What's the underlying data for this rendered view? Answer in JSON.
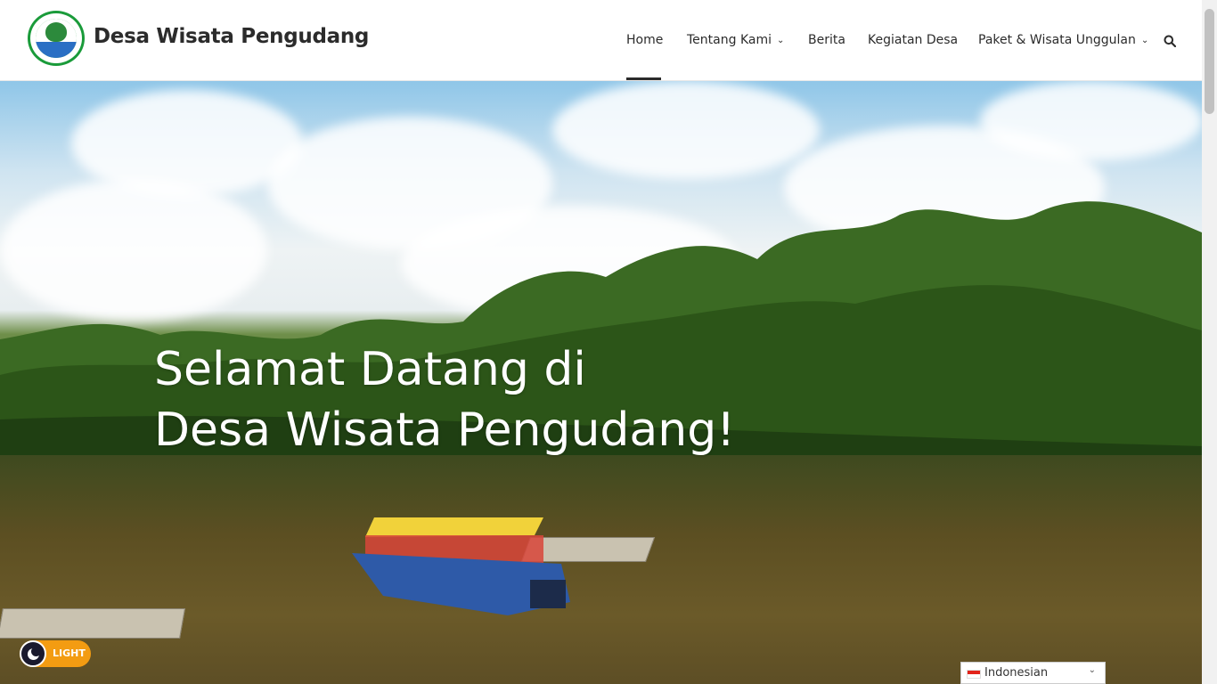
{
  "site": {
    "title": "Desa Wisata Pengudang",
    "logo_name": "pengudang-mangrove-logo"
  },
  "nav": {
    "items": [
      {
        "label": "Home",
        "active": true,
        "has_dropdown": false
      },
      {
        "label": "Tentang Kami",
        "active": false,
        "has_dropdown": true
      },
      {
        "label": "Berita",
        "active": false,
        "has_dropdown": false
      },
      {
        "label": "Kegiatan Desa",
        "active": false,
        "has_dropdown": false
      },
      {
        "label": "Paket & Wisata Unggulan",
        "active": false,
        "has_dropdown": true
      }
    ],
    "search_icon": "search-icon"
  },
  "hero": {
    "line1": "Selamat Datang di",
    "line2": "Desa Wisata Pengudang!"
  },
  "theme_toggle": {
    "label": "LIGHT",
    "icon": "moon-icon"
  },
  "language": {
    "selected": "Indonesian",
    "icon": "indonesia-flag-icon"
  },
  "colors": {
    "accent": "#2b2b2b",
    "toggle": "#f39c12",
    "logo_green": "#1a9b3a"
  }
}
